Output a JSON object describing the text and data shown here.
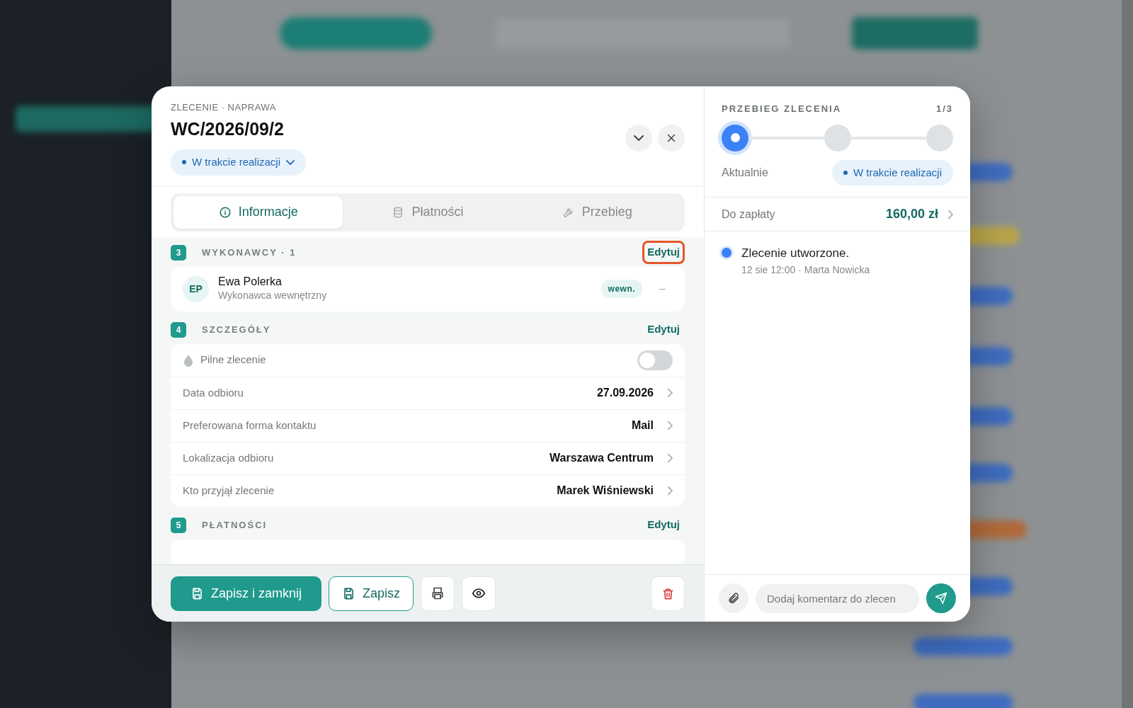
{
  "modal": {
    "eyebrow": "ZLECENIE · NAPRAWA",
    "title": "WC/2026/09/2",
    "status": "W trakcie realizacji",
    "tabs": [
      {
        "label": "Informacje",
        "selected": true
      },
      {
        "label": "Płatności",
        "selected": false
      },
      {
        "label": "Przebieg",
        "selected": false
      }
    ],
    "sections": [
      {
        "number": "3",
        "title": "WYKONAWCY · 1",
        "edit": "Edytuj",
        "focused": true,
        "kind": "people",
        "people": [
          {
            "initials": "EP",
            "name": "Ewa Polerka",
            "role": "Wykonawca wewnętrzny",
            "tag": "wewn.",
            "extra": "–"
          }
        ]
      },
      {
        "number": "4",
        "title": "SZCZEGÓŁY",
        "edit": "Edytuj",
        "focused": false,
        "kind": "details",
        "rows": [
          {
            "kind": "toggle",
            "label": "Pilne zlecenie",
            "on": false
          },
          {
            "kind": "value",
            "label": "Data odbioru",
            "value": "27.09.2026"
          },
          {
            "kind": "value",
            "label": "Preferowana forma kontaktu",
            "value": "Mail"
          },
          {
            "kind": "value",
            "label": "Lokalizacja odbioru",
            "value": "Warszawa Centrum"
          },
          {
            "kind": "value",
            "label": "Kto przyjął zlecenie",
            "value": "Marek Wiśniewski"
          }
        ]
      },
      {
        "number": "5",
        "title": "PŁATNOŚCI",
        "edit": "Edytuj",
        "focused": false,
        "kind": "payments"
      }
    ],
    "footer": {
      "save_close": "Zapisz i zamknij",
      "save": "Zapisz"
    },
    "progress": {
      "title": "PRZEBIEG ZLECENIA",
      "count": "1/3",
      "steps": [
        {
          "current": true
        },
        {
          "current": false
        },
        {
          "current": false
        }
      ],
      "current_label": "Aktualnie",
      "current_status": "W trakcie realizacji"
    },
    "due": {
      "label": "Do zapłaty",
      "amount": "160,00 zł"
    },
    "timeline": [
      {
        "title": "Zlecenie utworzone.",
        "meta": "12 sie 12:00 · Marta Nowicka",
        "color": "#3b82f6"
      }
    ],
    "comment": {
      "placeholder": "Dodaj komentarz do zlecen"
    }
  }
}
